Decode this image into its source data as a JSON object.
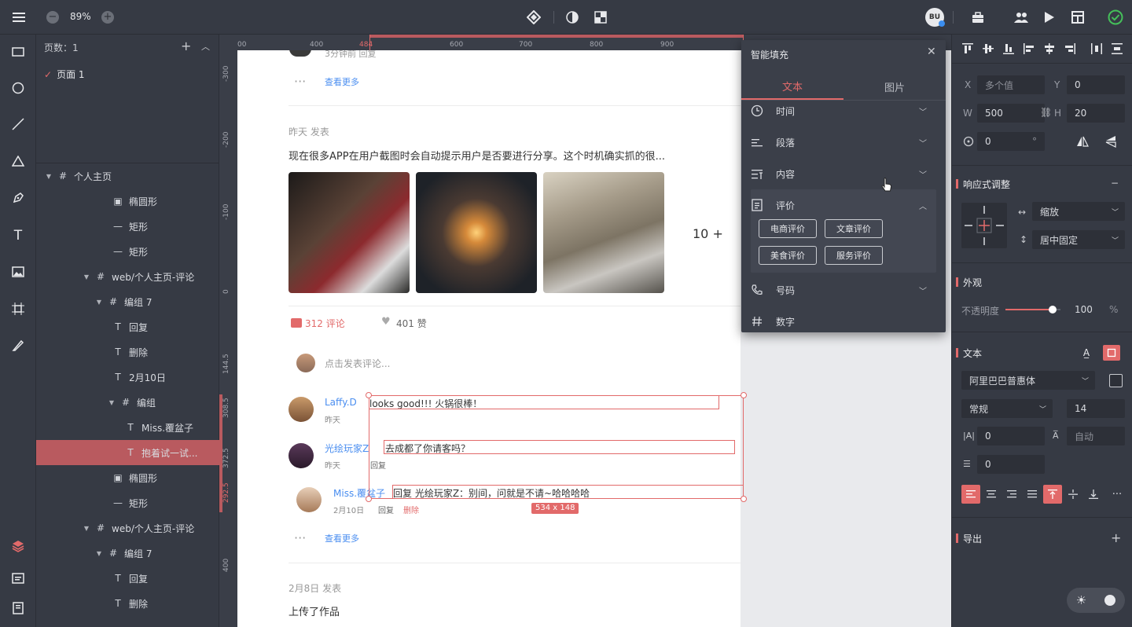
{
  "toolbar": {
    "zoom": "89%"
  },
  "pages": {
    "title": "页数：1",
    "items": [
      {
        "label": "页面 1"
      }
    ]
  },
  "layers": [
    {
      "label": "个人主页",
      "type": "artboard"
    },
    {
      "label": "椭圆形",
      "type": "image"
    },
    {
      "label": "矩形",
      "type": "rect"
    },
    {
      "label": "矩形",
      "type": "rect"
    },
    {
      "label": "web/个人主页-评论",
      "type": "artboard"
    },
    {
      "label": "编组 7",
      "type": "artboard"
    },
    {
      "label": "回复",
      "type": "text"
    },
    {
      "label": "删除",
      "type": "text"
    },
    {
      "label": "2月10日",
      "type": "text"
    },
    {
      "label": "编组",
      "type": "artboard"
    },
    {
      "label": "Miss.覆盆子",
      "type": "text"
    },
    {
      "label": "抱着试一试...",
      "type": "text",
      "selected": true
    },
    {
      "label": "椭圆形",
      "type": "image"
    },
    {
      "label": "矩形",
      "type": "rect"
    },
    {
      "label": "web/个人主页-评论",
      "type": "artboard"
    },
    {
      "label": "编组 7",
      "type": "artboard"
    },
    {
      "label": "回复",
      "type": "text"
    },
    {
      "label": "删除",
      "type": "text"
    }
  ],
  "ruler": {
    "top": [
      "00",
      "400",
      "484",
      "600",
      "700",
      "800",
      "900"
    ],
    "left": [
      "-300",
      "-200",
      "-100",
      "0",
      "144.5",
      "308.5",
      "372.5",
      "292.5",
      "400"
    ]
  },
  "canvas": {
    "top_partial": "3分钟前   回复",
    "more1": "查看更多",
    "post_time": "昨天 发表",
    "post_text": "现在很多APP在用户截图时会自动提示用户是否要进行分享。这个时机确实抓的很...",
    "more_count": "10 +",
    "comments_count": "312 评论",
    "likes": "401 赞",
    "comment_placeholder": "点击发表评论...",
    "comments": [
      {
        "name": "Laffy.D",
        "text": "looks good!!! 火锅很棒！",
        "time": "昨天",
        "reply": ""
      },
      {
        "name": "光绘玩家Z",
        "text": "去成都了你请客吗？",
        "time": "昨天",
        "reply": "回复"
      },
      {
        "name": "Miss.覆盆子",
        "text": "回复 光绘玩家Z：别间，问就是不请~哈哈哈哈",
        "time": "2月10日",
        "reply": "回复",
        "delete": "删除"
      }
    ],
    "size_badge": "534 x 148",
    "more2": "查看更多",
    "post2_time": "2月8日 发表",
    "post2_text": "上传了作品"
  },
  "fill_panel": {
    "title": "智能填充",
    "tabs": [
      {
        "label": "文本"
      },
      {
        "label": "图片"
      }
    ],
    "items": [
      {
        "label": "时间",
        "icon": "clock-icon"
      },
      {
        "label": "段落",
        "icon": "paragraph-icon"
      },
      {
        "label": "内容",
        "icon": "content-icon"
      },
      {
        "label": "评价",
        "icon": "review-icon"
      },
      {
        "label": "号码",
        "icon": "phone-icon"
      },
      {
        "label": "数字",
        "icon": "number-icon"
      }
    ],
    "tags": [
      "电商评价",
      "文章评价",
      "美食评价",
      "服务评价"
    ]
  },
  "props": {
    "x_label": "X",
    "x": "多个值",
    "y_label": "Y",
    "y": "0",
    "w_label": "W",
    "w": "500",
    "h_label": "H",
    "h": "20",
    "rotate": "0",
    "rotate_unit": "°",
    "responsive": "响应式调整",
    "scale": "缩放",
    "center_fixed": "居中固定",
    "appearance": "外观",
    "opacity_label": "不透明度",
    "opacity": "100",
    "opacity_unit": "%",
    "opacity_level": 0.85,
    "text_section": "文本",
    "font": "阿里巴巴普惠体",
    "weight": "常规",
    "size": "14",
    "letter": "0",
    "line": "自动",
    "para": "0",
    "export": "导出"
  },
  "colors": {
    "accent": "#e26a6a",
    "link": "#4a8ef0",
    "panel": "#363a44",
    "selected": "#b95a5f"
  }
}
